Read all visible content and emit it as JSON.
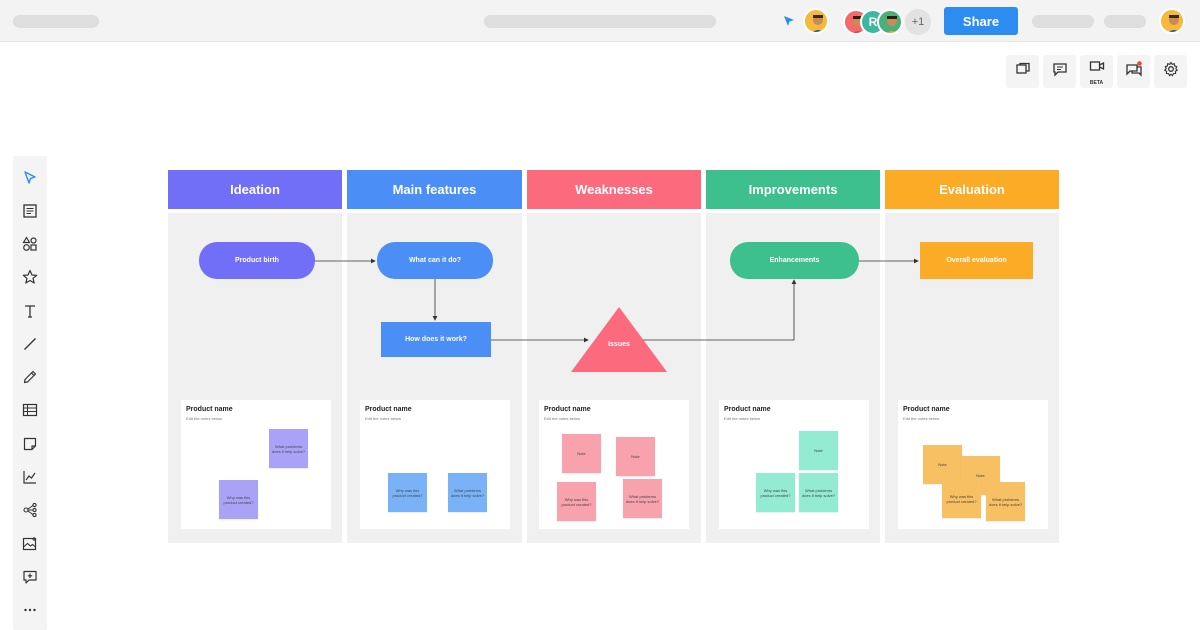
{
  "header": {
    "share_label": "Share",
    "extra_collaborators": "+1",
    "collaborator_initial": "R"
  },
  "toolbar": {
    "beta_label": "BETA"
  },
  "columns": [
    {
      "title": "Ideation",
      "color": "#716ef8"
    },
    {
      "title": "Main features",
      "color": "#4b8ef5"
    },
    {
      "title": "Weaknesses",
      "color": "#fb6b7d"
    },
    {
      "title": "Improvements",
      "color": "#3ebf8e"
    },
    {
      "title": "Evaluation",
      "color": "#fbab26"
    }
  ],
  "flow": {
    "product_birth": "Product birth",
    "what_can_it_do": "What can it do?",
    "how_does_it_work": "How does it work?",
    "issues": "Issues",
    "enhancements": "Enhancements",
    "overall_evaluation": "Overall evaluation"
  },
  "cards": [
    {
      "title": "Product name",
      "subtitle": "Edit the notes below",
      "notes": [
        "What problems does it help solve?",
        "Why was this product created?"
      ]
    },
    {
      "title": "Product name",
      "subtitle": "Edit the notes below",
      "notes": [
        "Why was this product created?",
        "What problems does it help solve?"
      ]
    },
    {
      "title": "Product name",
      "subtitle": "Edit the notes below",
      "notes": [
        "Note",
        "Note",
        "Why was this product created?",
        "What problems does it help solve?"
      ]
    },
    {
      "title": "Product name",
      "subtitle": "Edit the notes below",
      "notes": [
        "Note",
        "Why was this product created?",
        "What problems does it help solve?"
      ]
    },
    {
      "title": "Product name",
      "subtitle": "Edit the notes below",
      "notes": [
        "Note",
        "Note",
        "Why was this product created?",
        "What problems does it help solve?"
      ]
    }
  ],
  "colors": {
    "ideation_note": "#a9a3f7",
    "features_note": "#79b2f7",
    "weakness_note": "#f7a2ac",
    "improvement_note": "#93ebd2",
    "evaluation_note": "#f7c062",
    "share_button": "#2d8cf0"
  },
  "icons": {
    "sidebar": [
      "cursor-icon",
      "template-icon",
      "shapes-icon",
      "star-icon",
      "text-icon",
      "line-icon",
      "pen-icon",
      "table-icon",
      "sticky-note-icon",
      "chart-icon",
      "mind-map-icon",
      "image-icon",
      "add-frame-icon",
      "more-icon"
    ],
    "toolbar": [
      "pages-icon",
      "comment-icon",
      "video-icon",
      "chat-icon",
      "settings-icon"
    ]
  }
}
